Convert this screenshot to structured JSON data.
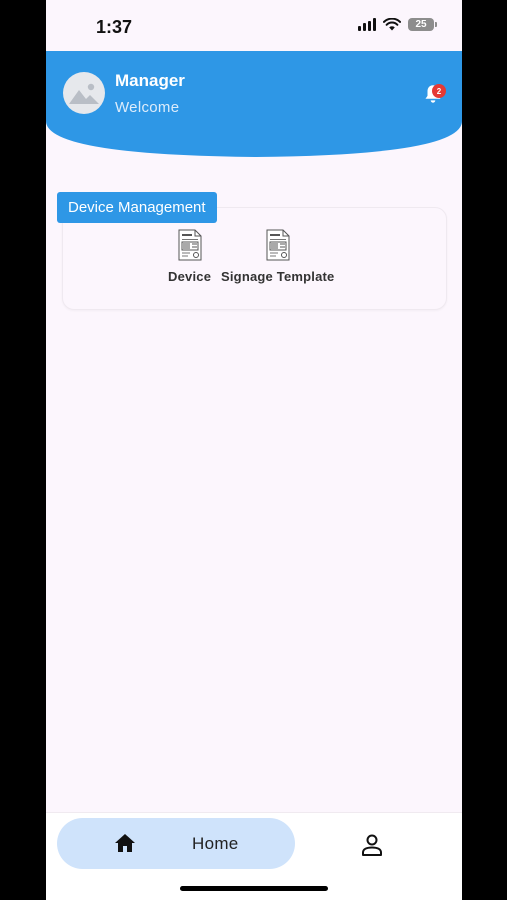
{
  "status_bar": {
    "time": "1:37",
    "battery": "25",
    "icons": [
      "signal-icon",
      "wifi-icon",
      "battery-icon"
    ]
  },
  "header": {
    "title": "Manager",
    "subtitle": "Welcome",
    "notification_count": "2",
    "colors": {
      "background": "#2e97e6",
      "badge": "#e53935"
    },
    "icons": [
      "avatar-placeholder-icon",
      "bell-icon"
    ]
  },
  "section": {
    "title": "Device Management",
    "items": [
      {
        "label": "Device",
        "icon": "invoice-document-icon"
      },
      {
        "label": "Signage Template",
        "icon": "invoice-document-icon"
      }
    ]
  },
  "bottom_nav": {
    "items": [
      {
        "label": "Home",
        "icon": "home-icon",
        "active": true
      },
      {
        "label": "",
        "icon": "profile-icon",
        "active": false
      }
    ],
    "colors": {
      "active_pill": "#cfe3fb"
    }
  }
}
